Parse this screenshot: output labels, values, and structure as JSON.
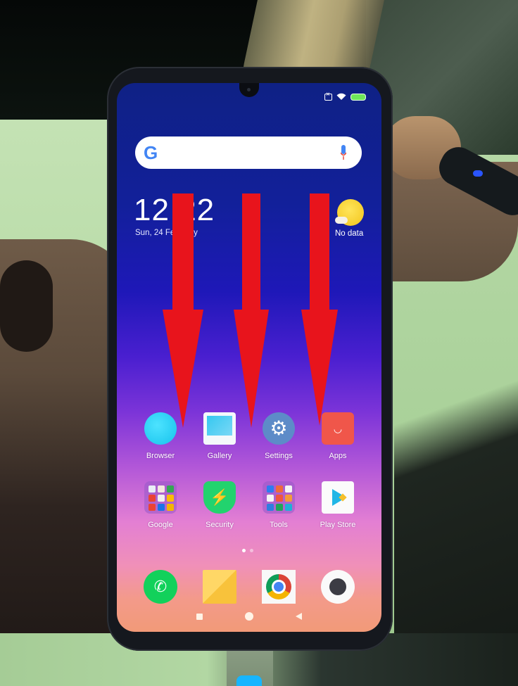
{
  "status_bar": {
    "icons": [
      "no-sim-icon",
      "wifi-icon",
      "battery-icon"
    ],
    "battery_color": "#6fe65a"
  },
  "search_widget": {
    "logo": "G",
    "mic_icon": "microphone-icon"
  },
  "clock_widget": {
    "time": "12:22",
    "date": "Sun, 24 February"
  },
  "weather_widget": {
    "icon": "sun-cloud-icon",
    "label": "No data"
  },
  "home_grid": {
    "row1": [
      {
        "label": "Browser",
        "icon": "browser-icon"
      },
      {
        "label": "Gallery",
        "icon": "gallery-icon"
      },
      {
        "label": "Settings",
        "icon": "gear-icon",
        "glyph": "⚙"
      },
      {
        "label": "Apps",
        "icon": "shopping-bag-icon",
        "glyph": "◡"
      }
    ],
    "row2": [
      {
        "label": "Google",
        "icon": "folder-icon"
      },
      {
        "label": "Security",
        "icon": "shield-bolt-icon",
        "glyph": "⚡"
      },
      {
        "label": "Tools",
        "icon": "folder-icon"
      },
      {
        "label": "Play Store",
        "icon": "play-store-icon"
      }
    ]
  },
  "page_indicator": {
    "pages": 2,
    "current": 1
  },
  "dock": [
    {
      "label": "Phone",
      "icon": "phone-icon",
      "glyph": "✆"
    },
    {
      "label": "Notes",
      "icon": "notes-icon"
    },
    {
      "label": "Chrome",
      "icon": "chrome-icon"
    },
    {
      "label": "Camera",
      "icon": "camera-icon"
    }
  ],
  "nav_bar": [
    "recents-button",
    "home-button",
    "back-button"
  ],
  "annotations": {
    "arrow_color": "#e8141c",
    "arrows": [
      {
        "points_to": "Browser"
      },
      {
        "points_to": "Gallery"
      },
      {
        "points_to": "Apps"
      }
    ]
  },
  "colors": {
    "wallpaper_top": "#0f2185",
    "wallpaper_mid": "#7c34d8",
    "wallpaper_bottom": "#f29a78"
  }
}
